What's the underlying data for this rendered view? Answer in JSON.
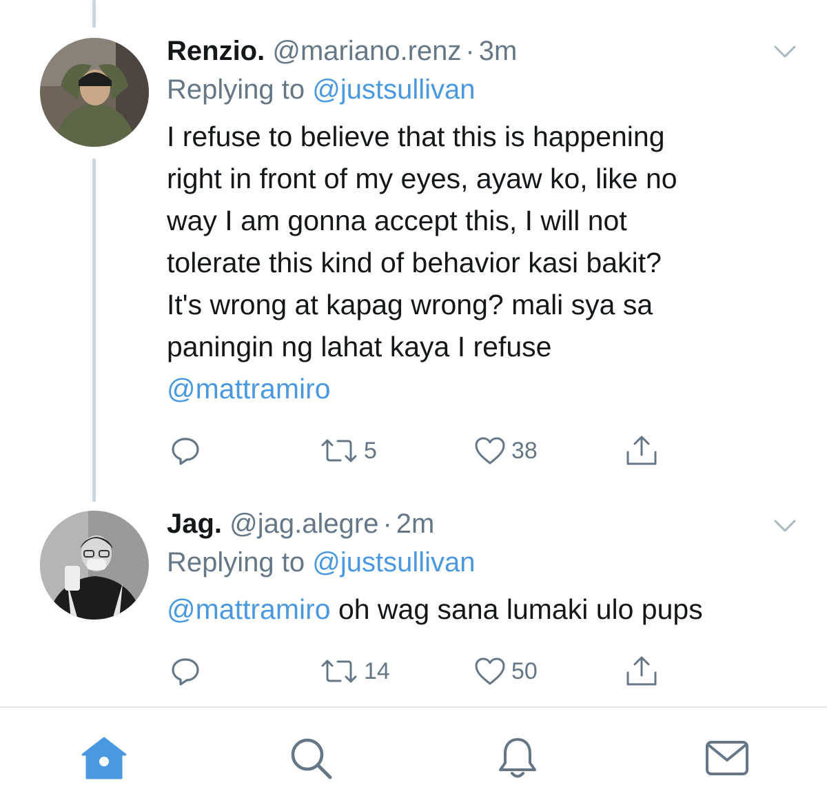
{
  "tweets": [
    {
      "display_name": "Renzio.",
      "handle": "@mariano.renz",
      "separator": "·",
      "time": "3m",
      "replying_prefix": "Replying to ",
      "replying_handle": "@justsullivan",
      "body_lines": [
        "I refuse to believe that this is happening",
        "right in front of my eyes, ayaw ko, like no",
        "way I am gonna accept this, I will not",
        "tolerate this kind of behavior kasi bakit?",
        "It's wrong at kapag wrong? mali sya sa",
        "paningin ng lahat kaya I refuse"
      ],
      "mention_line": "@mattramiro",
      "retweets": "5",
      "likes": "38"
    },
    {
      "display_name": "Jag.",
      "handle": "@jag.alegre",
      "separator": "·",
      "time": "2m",
      "replying_prefix": "Replying to ",
      "replying_handle": "@justsullivan",
      "body_mention": "@mattramiro",
      "body_text": " oh wag sana lumaki ulo pups",
      "retweets": "14",
      "likes": "50"
    }
  ],
  "icons": {
    "reply": "reply-icon",
    "retweet": "retweet-icon",
    "like": "heart-icon",
    "share": "share-icon",
    "more": "chevron-down-icon"
  },
  "tabbar": {
    "active": "home",
    "items": [
      "home",
      "search",
      "notifications",
      "messages"
    ]
  },
  "colors": {
    "accent": "#4a99e0",
    "secondary_text": "#657786",
    "primary_text": "#14171a",
    "thread_line": "#ccd6dd"
  }
}
